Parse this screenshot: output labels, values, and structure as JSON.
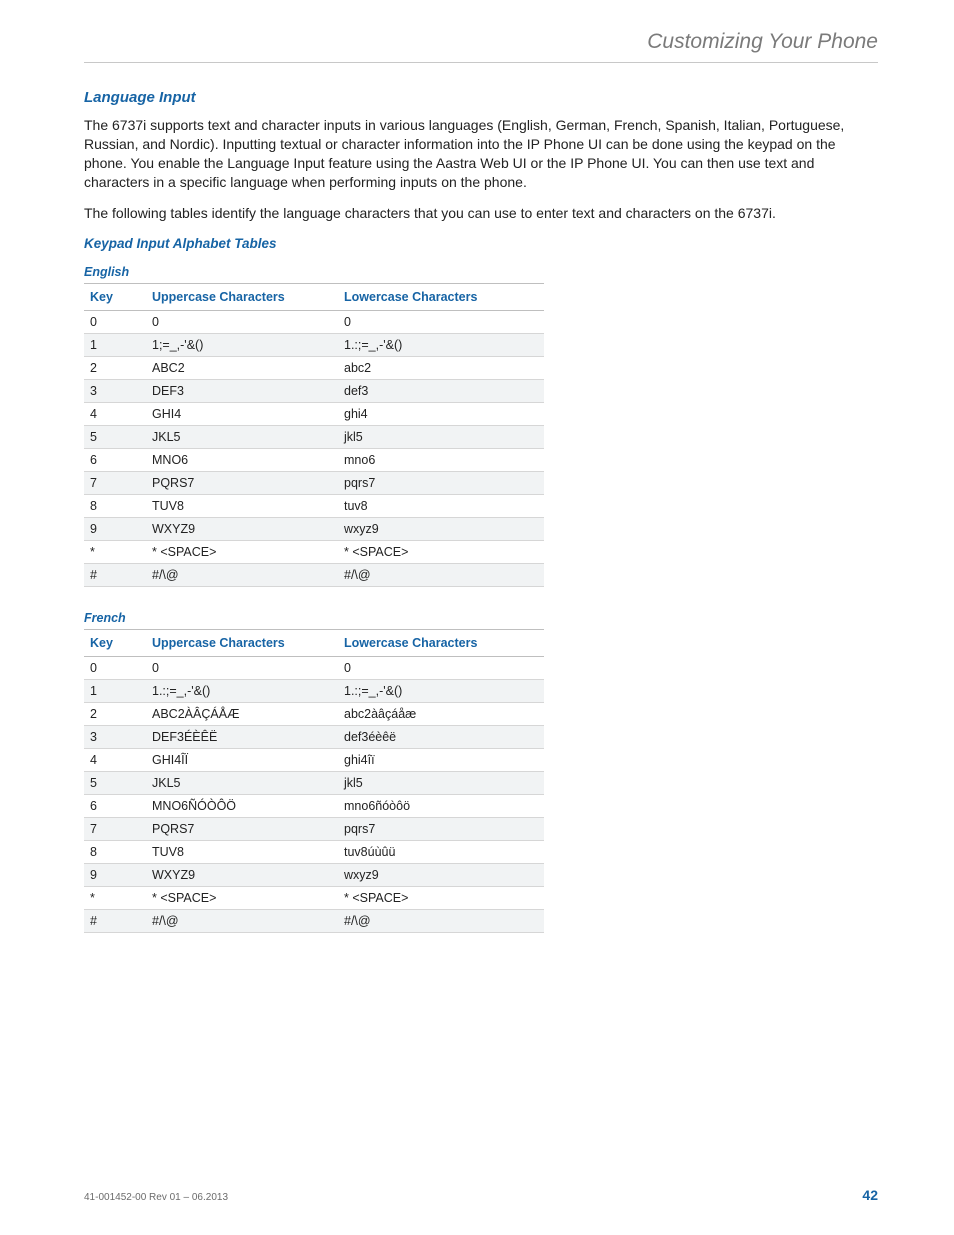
{
  "header": {
    "running": "Customizing Your Phone"
  },
  "section": {
    "h3": "Language Input",
    "p1": "The 6737i supports text and character inputs in various languages (English, German, French, Spanish, Italian, Portuguese, Russian, and Nordic). Inputting textual or character information into the IP Phone UI can be done using the keypad on the phone. You enable the Language Input feature using the Aastra Web UI or the IP Phone UI. You can then use text and characters in a specific language when performing inputs on the phone.",
    "p2": "The following tables identify the language characters that you can use to enter text and characters on the 6737i.",
    "h4": "Keypad Input Alphabet Tables"
  },
  "columns": {
    "key": "Key",
    "upper": "Uppercase Characters",
    "lower": "Lowercase Characters"
  },
  "tables": {
    "english": {
      "title": "English",
      "rows": [
        {
          "key": "0",
          "upper": "0",
          "lower": "0"
        },
        {
          "key": "1",
          "upper": "1;=_,-'&()",
          "lower": "1.:;=_,-'&()"
        },
        {
          "key": "2",
          "upper": "ABC2",
          "lower": "abc2"
        },
        {
          "key": "3",
          "upper": "DEF3",
          "lower": "def3"
        },
        {
          "key": "4",
          "upper": "GHI4",
          "lower": "ghi4"
        },
        {
          "key": "5",
          "upper": "JKL5",
          "lower": "jkl5"
        },
        {
          "key": "6",
          "upper": "MNO6",
          "lower": "mno6"
        },
        {
          "key": "7",
          "upper": "PQRS7",
          "lower": "pqrs7"
        },
        {
          "key": "8",
          "upper": "TUV8",
          "lower": "tuv8"
        },
        {
          "key": "9",
          "upper": "WXYZ9",
          "lower": "wxyz9"
        },
        {
          "key": "*",
          "upper": "* <SPACE>",
          "lower": "* <SPACE>"
        },
        {
          "key": "#",
          "upper": "#/\\@",
          "lower": "#/\\@"
        }
      ]
    },
    "french": {
      "title": "French",
      "rows": [
        {
          "key": "0",
          "upper": "0",
          "lower": "0"
        },
        {
          "key": "1",
          "upper": "1.:;=_,-'&()",
          "lower": "1.:;=_,-'&()"
        },
        {
          "key": "2",
          "upper": "ABC2ÀÂÇÁÅÆ",
          "lower": "abc2àâçáåæ"
        },
        {
          "key": "3",
          "upper": "DEF3ÉÈÊË",
          "lower": "def3éèêë"
        },
        {
          "key": "4",
          "upper": "GHI4ÎÏ",
          "lower": "ghi4îï"
        },
        {
          "key": "5",
          "upper": "JKL5",
          "lower": "jkl5"
        },
        {
          "key": "6",
          "upper": "MNO6ÑÓÒÔÖ",
          "lower": "mno6ñóòôö"
        },
        {
          "key": "7",
          "upper": "PQRS7",
          "lower": "pqrs7"
        },
        {
          "key": "8",
          "upper": "TUV8",
          "lower": "tuv8úùûü"
        },
        {
          "key": "9",
          "upper": "WXYZ9",
          "lower": "wxyz9"
        },
        {
          "key": "*",
          "upper": "* <SPACE>",
          "lower": "* <SPACE>"
        },
        {
          "key": "#",
          "upper": "#/\\@",
          "lower": "#/\\@"
        }
      ]
    }
  },
  "footer": {
    "rev": "41-001452-00 Rev 01 – 06.2013",
    "page": "42"
  }
}
